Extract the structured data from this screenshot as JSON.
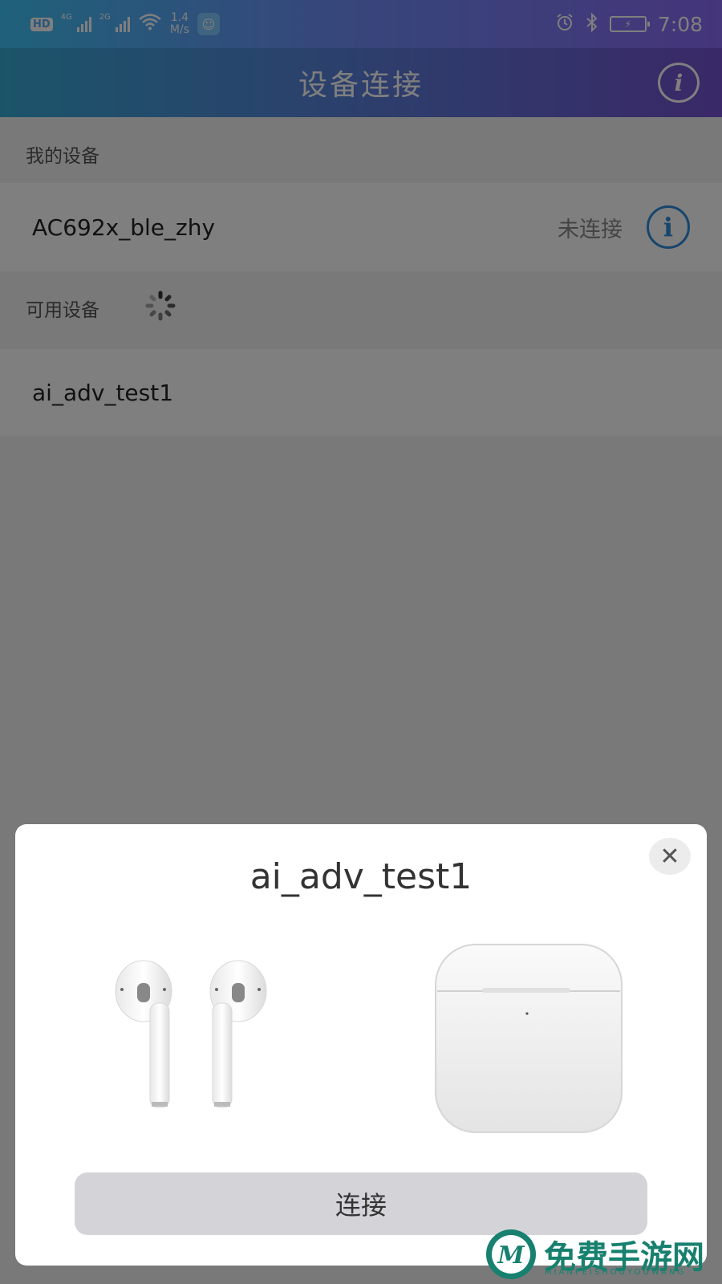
{
  "status_bar": {
    "hd": "HD",
    "sim1_net": "4G",
    "sim2_net": "2G",
    "speed_value": "1.4",
    "speed_unit": "M/s",
    "time": "7:08"
  },
  "header": {
    "title": "设备连接",
    "info_icon": "i"
  },
  "my_devices": {
    "label": "我的设备",
    "items": [
      {
        "name": "AC692x_ble_zhy",
        "status": "未连接",
        "info_icon": "i"
      }
    ]
  },
  "available_devices": {
    "label": "可用设备",
    "items": [
      {
        "name": "ai_adv_test1"
      }
    ]
  },
  "dialog": {
    "title": "ai_adv_test1",
    "close_icon": "✕",
    "connect_label": "连接"
  },
  "watermark": {
    "text": "免费手游网",
    "sub": "MIANFEISHOUYOUWANG"
  },
  "colors": {
    "accent": "#2e8bd8",
    "watermark": "#17806e"
  }
}
